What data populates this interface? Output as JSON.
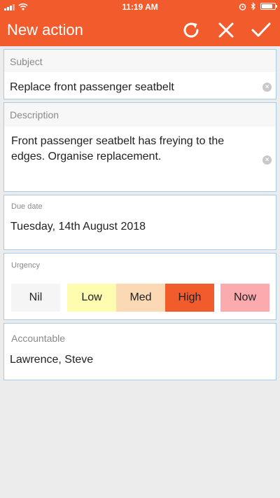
{
  "status_bar": {
    "time": "11:19 AM",
    "icons": [
      "signal-icon",
      "wifi-icon",
      "alarm-icon",
      "bluetooth-icon",
      "battery-icon"
    ]
  },
  "app_bar": {
    "title": "New action",
    "actions": [
      "refresh-icon",
      "close-icon",
      "check-icon"
    ]
  },
  "form": {
    "subject": {
      "label": "Subject",
      "value": "Replace front passenger seatbelt"
    },
    "description": {
      "label": "Description",
      "value": "Front passenger seatbelt has freying to the edges. Organise replacement."
    },
    "due_date": {
      "label": "Due date",
      "value": "Tuesday, 14th August 2018"
    },
    "urgency": {
      "label": "Urgency",
      "options": [
        "Nil",
        "Low",
        "Med",
        "High",
        "Now"
      ],
      "selected": "High"
    },
    "accountable": {
      "label": "Accountable",
      "value": "Lawrence, Steve"
    }
  },
  "colors": {
    "accent": "#f25c2c",
    "card_border": "#a9cce6",
    "background": "#ececec",
    "urgency_nil": "#f5f5f5",
    "urgency_low": "#fdfcaf",
    "urgency_med": "#fcd9b5",
    "urgency_high": "#f25c2c",
    "urgency_now": "#fbaaae"
  }
}
